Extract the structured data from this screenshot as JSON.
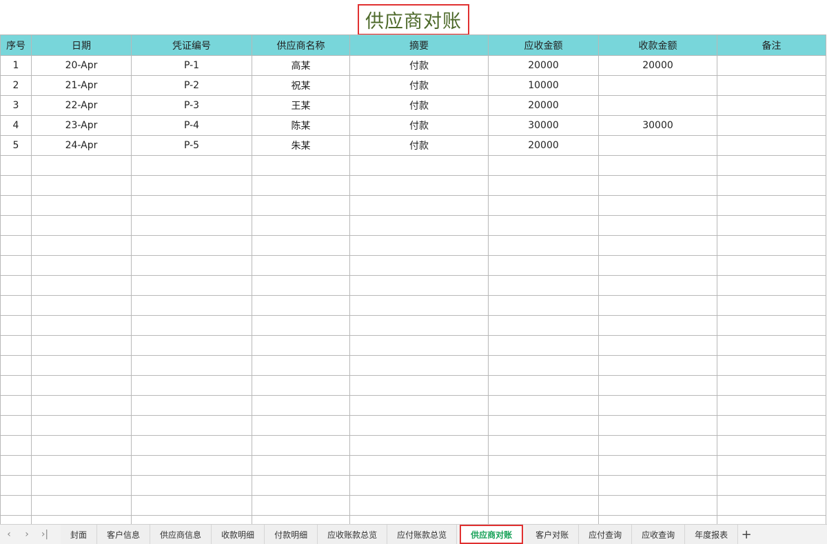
{
  "sheet_title": "供应商对账",
  "table": {
    "headers": [
      "序号",
      "日期",
      "凭证编号",
      "供应商名称",
      "摘要",
      "应收金额",
      "收款金额",
      "备注"
    ],
    "rows": [
      [
        "1",
        "20-Apr",
        "P-1",
        "高某",
        "付款",
        "20000",
        "20000",
        ""
      ],
      [
        "2",
        "21-Apr",
        "P-2",
        "祝某",
        "付款",
        "10000",
        "",
        ""
      ],
      [
        "3",
        "22-Apr",
        "P-3",
        "王某",
        "付款",
        "20000",
        "",
        ""
      ],
      [
        "4",
        "23-Apr",
        "P-4",
        "陈某",
        "付款",
        "30000",
        "30000",
        ""
      ],
      [
        "5",
        "24-Apr",
        "P-5",
        "朱某",
        "付款",
        "20000",
        "",
        ""
      ]
    ],
    "empty_rows": 19
  },
  "tabbar": {
    "nav_icons": [
      "chevron-left-icon",
      "chevron-right-icon",
      "last-sheet-icon"
    ],
    "tabs": [
      "封面",
      "客户信息",
      "供应商信息",
      "收款明细",
      "付款明细",
      "应收账款总览",
      "应付账款总览",
      "供应商对账",
      "客户对账",
      "应付查询",
      "应收查询",
      "年度报表"
    ],
    "active_tab": "供应商对账",
    "add_label": "+"
  },
  "colors": {
    "header_bg": "#78d6da",
    "title_color": "#4e6a2b",
    "highlight_border": "#e03030",
    "active_tab_text": "#1aa35a"
  }
}
